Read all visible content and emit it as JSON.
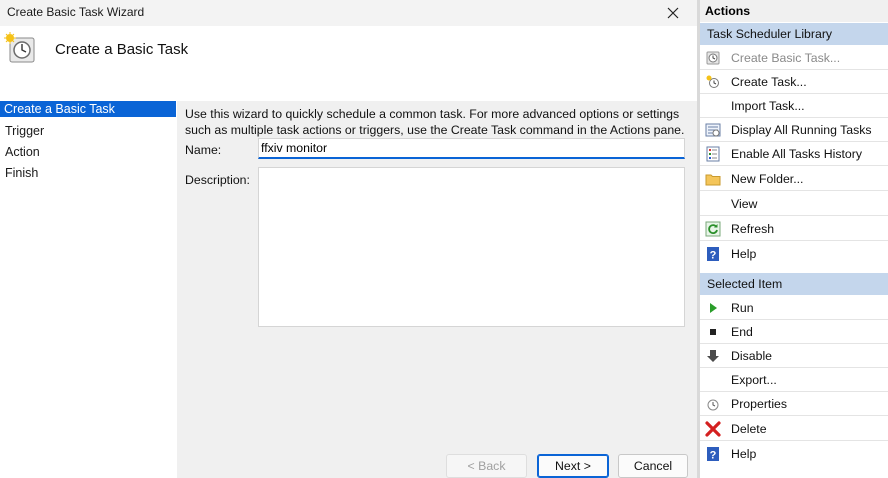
{
  "wizard": {
    "window_title": "Create Basic Task Wizard",
    "heading": "Create a Basic Task",
    "steps": [
      "Create a Basic Task",
      "Trigger",
      "Action",
      "Finish"
    ],
    "intro": "Use this wizard to quickly schedule a common task.  For more advanced options or settings such as multiple task actions or triggers, use the Create Task command in the Actions pane.",
    "name_label": "Name:",
    "name_value": "ffxiv monitor",
    "description_label": "Description:",
    "description_value": "",
    "buttons": {
      "back": "< Back",
      "next": "Next >",
      "cancel": "Cancel"
    }
  },
  "actions_pane": {
    "title": "Actions",
    "library_header": "Task Scheduler Library",
    "library_items": [
      {
        "label": "Create Basic Task...",
        "icon": "create-basic-task-icon"
      },
      {
        "label": "Create Task...",
        "icon": "create-task-icon"
      },
      {
        "label": "Import Task...",
        "icon": "none"
      },
      {
        "label": "Display All Running Tasks",
        "icon": "display-running-tasks-icon"
      },
      {
        "label": "Enable All Tasks History",
        "icon": "tasks-history-icon"
      },
      {
        "label": "New Folder...",
        "icon": "folder-icon"
      },
      {
        "label": "View",
        "icon": "none"
      },
      {
        "label": "Refresh",
        "icon": "refresh-icon"
      },
      {
        "label": "Help",
        "icon": "help-icon"
      }
    ],
    "selected_header": "Selected Item",
    "selected_items": [
      {
        "label": "Run",
        "icon": "run-icon"
      },
      {
        "label": "End",
        "icon": "end-icon"
      },
      {
        "label": "Disable",
        "icon": "disable-icon"
      },
      {
        "label": "Export...",
        "icon": "none"
      },
      {
        "label": "Properties",
        "icon": "properties-icon"
      },
      {
        "label": "Delete",
        "icon": "delete-icon"
      },
      {
        "label": "Help",
        "icon": "help-icon"
      }
    ]
  },
  "colors": {
    "accent": "#0a64d6",
    "section_header": "#c4d6ec"
  }
}
